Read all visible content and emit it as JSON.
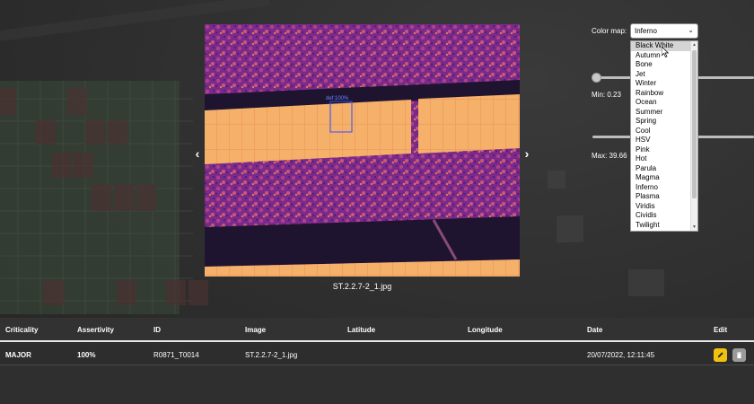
{
  "viewer": {
    "prev_arrow": "‹",
    "next_arrow": "›",
    "caption": "ST.2.2.7-2_1.jpg",
    "detection_label": "def:100%"
  },
  "colormap": {
    "label": "Color map:",
    "selected": "Inferno",
    "highlighted": "Black White",
    "options": [
      "Black White",
      "Autumn",
      "Bone",
      "Jet",
      "Winter",
      "Rainbow",
      "Ocean",
      "Summer",
      "Spring",
      "Cool",
      "HSV",
      "Pink",
      "Hot",
      "Parula",
      "Magma",
      "Inferno",
      "Plasma",
      "Viridis",
      "Cividis",
      "Twilight"
    ]
  },
  "range": {
    "min_label": "Min: 0.23",
    "max_label": "Max: 39.66"
  },
  "table": {
    "headers": {
      "criticality": "Criticality",
      "assertivity": "Assertivity",
      "id": "ID",
      "image": "Image",
      "latitude": "Latitude",
      "longitude": "Longitude",
      "date": "Date",
      "edit": "Edit"
    },
    "rows": [
      {
        "criticality": "MAJOR",
        "assertivity": "100%",
        "id": "R0871_T0014",
        "image": "ST.2.2.7-2_1.jpg",
        "latitude": "",
        "longitude": "",
        "date": "20/07/2022, 12:11:45"
      }
    ]
  },
  "icons": {
    "edit": "pencil-icon",
    "delete": "trash-icon"
  },
  "colors": {
    "accent_edit": "#f0c20f",
    "background": "#2e2e2e"
  }
}
